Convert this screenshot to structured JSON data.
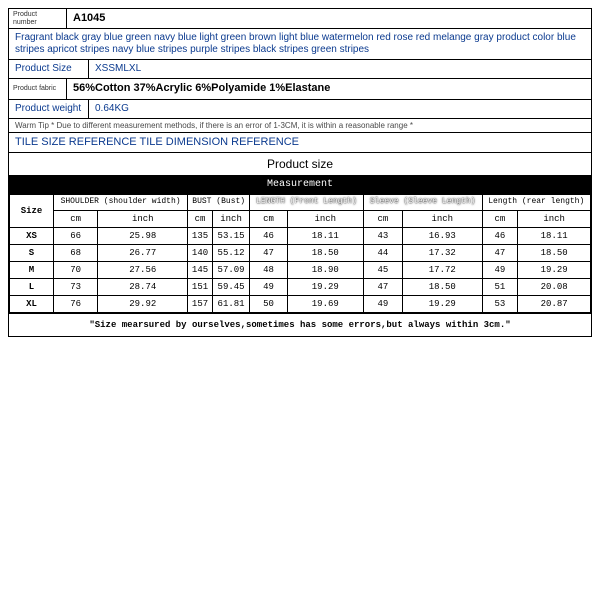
{
  "info": {
    "product_number_label": "Product number",
    "product_number": "A1045",
    "description": "Fragrant black gray blue green navy blue light green brown light blue watermelon red rose red melange gray product color blue stripes apricot stripes navy blue stripes purple stripes black stripes green stripes",
    "size_label": "Product Size",
    "size_value": "XSSMLXL",
    "fabric_label": "Product fabric",
    "fabric_value": "56%Cotton 37%Acrylic 6%Polyamide 1%Elastane",
    "weight_label": "Product weight",
    "weight_value": "0.64KG",
    "warm_tip_label": "Warm Tip",
    "warm_tip_text": "* Due to different measurement methods, if there is an error of 1-3CM, it is within a reasonable range *",
    "tile_ref": "TILE SIZE REFERENCE TILE DIMENSION REFERENCE",
    "prod_size_title": "Product size",
    "measurement_label": "Measurement"
  },
  "chart_data": {
    "type": "table",
    "size_header": "Size",
    "unit_headers": [
      "cm",
      "inch"
    ],
    "groups": [
      "SHOULDER (shoulder width)",
      "BUST (Bust)",
      "LENGTH (Front Length)",
      "Sleeve (Sleeve Length)",
      "Length (rear length)"
    ],
    "rows": [
      {
        "size": "XS",
        "vals": [
          66,
          25.98,
          135,
          53.15,
          46,
          18.11,
          43,
          16.93,
          46,
          18.11
        ]
      },
      {
        "size": "S",
        "vals": [
          68,
          26.77,
          140,
          55.12,
          47,
          18.5,
          44,
          17.32,
          47,
          18.5
        ]
      },
      {
        "size": "M",
        "vals": [
          70,
          27.56,
          145,
          57.09,
          48,
          18.9,
          45,
          17.72,
          49,
          19.29
        ]
      },
      {
        "size": "L",
        "vals": [
          73,
          28.74,
          151,
          59.45,
          49,
          19.29,
          47,
          18.5,
          51,
          20.08
        ]
      },
      {
        "size": "XL",
        "vals": [
          76,
          29.92,
          157,
          61.81,
          50,
          19.69,
          49,
          19.29,
          53,
          20.87
        ]
      }
    ],
    "footnote": "\"Size mearsured by ourselves,sometimes has some errors,but always within 3cm.\""
  }
}
